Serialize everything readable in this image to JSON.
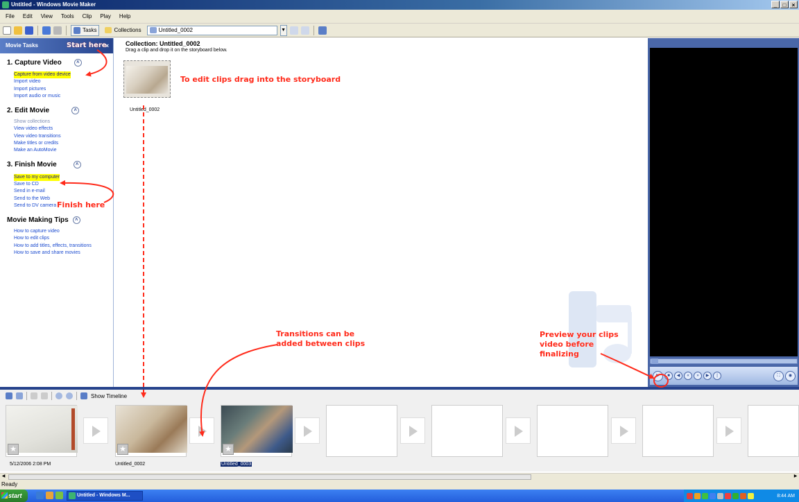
{
  "window": {
    "title": "Untitled - Windows Movie Maker",
    "buttons": [
      "_",
      "□",
      "×"
    ]
  },
  "menu": [
    "File",
    "Edit",
    "View",
    "Tools",
    "Clip",
    "Play",
    "Help"
  ],
  "toolbar": {
    "tasks_label": "Tasks",
    "collections_label": "Collections",
    "collection_value": "Untitled_0002"
  },
  "taskpane": {
    "header": "Movie Tasks",
    "close": "×",
    "sections": [
      {
        "title": "1. Capture Video",
        "links": [
          "Capture from video device",
          "Import video",
          "Import pictures",
          "Import audio or music"
        ]
      },
      {
        "title": "2. Edit Movie",
        "links": [
          "Show collections",
          "View video effects",
          "View video transitions",
          "Make titles or credits",
          "Make an AutoMovie"
        ]
      },
      {
        "title": "3. Finish Movie",
        "links": [
          "Save to my computer",
          "Save to CD",
          "Send in e-mail",
          "Send to the Web",
          "Send to DV camera"
        ]
      },
      {
        "title": "Movie Making Tips",
        "links": [
          "How to capture video",
          "How to edit clips",
          "How to add titles, effects, transitions",
          "How to save and share movies"
        ]
      }
    ],
    "chevron": "˄"
  },
  "content": {
    "title": "Collection: Untitled_0002",
    "subtitle": "Drag a clip and drop it on the storyboard below.",
    "clip_label": "Untitled_0002"
  },
  "storyboard": {
    "show_timeline": "Show Timeline",
    "frames": [
      {
        "label": "5/12/2006 2:08 PM"
      },
      {
        "label": "Untitled_0002"
      },
      {
        "label": "Untitled_0003",
        "selected": true
      },
      {
        "label": ""
      },
      {
        "label": ""
      },
      {
        "label": ""
      },
      {
        "label": ""
      }
    ]
  },
  "status": "Ready",
  "taskbar": {
    "start": "start",
    "task": "Untitled - Windows M...",
    "clock": "8:44 AM"
  },
  "annotations": {
    "start_here": "Start here",
    "finish_here": "Finish here",
    "edit_clips": "To edit clips drag into the storyboard",
    "transitions": [
      "Transitions can be",
      "added between clips"
    ],
    "preview": [
      "Preview your clips",
      "video before",
      "finalizing"
    ]
  },
  "colors": {
    "annotation": "#ff2a1a",
    "highlight": "#ffff00",
    "link": "#1a4acf",
    "pane_header": "#26438c"
  }
}
